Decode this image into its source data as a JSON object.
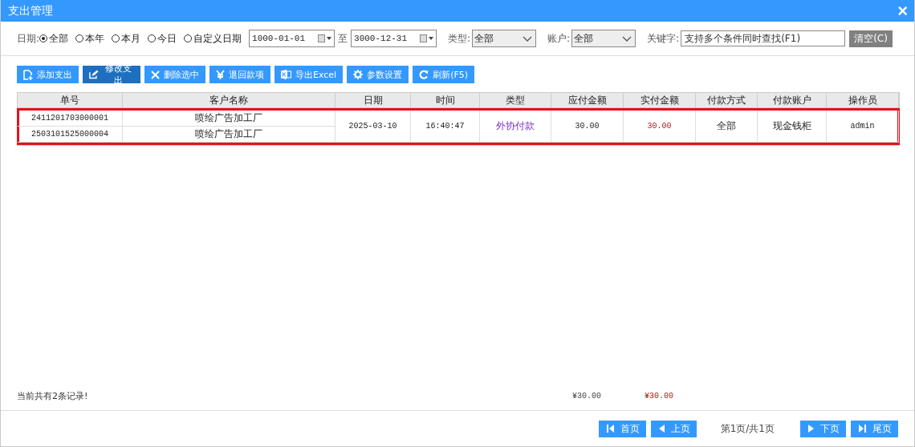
{
  "window": {
    "title": "支出管理",
    "close": "×"
  },
  "filters": {
    "date_label": "日期:",
    "date_options": [
      {
        "label": "全部",
        "selected": true
      },
      {
        "label": "本年",
        "selected": false
      },
      {
        "label": "本月",
        "selected": false
      },
      {
        "label": "今日",
        "selected": false
      },
      {
        "label": "自定义日期",
        "selected": false
      }
    ],
    "date_from": "1000-01-01",
    "date_sep": "至",
    "date_to": "3000-12-31",
    "type_label": "类型:",
    "type_value": "全部",
    "account_label": "账户:",
    "account_value": "全部",
    "keyword_label": "关键字:",
    "keyword_placeholder": "支持多个条件同时查找(F1)",
    "clear_button": "清空(C)"
  },
  "toolbar": [
    {
      "label": "添加支出",
      "kind": "add",
      "selected": false
    },
    {
      "label": "修改支出",
      "kind": "edit",
      "selected": true
    },
    {
      "label": "删除选中",
      "kind": "delete",
      "selected": false
    },
    {
      "label": "退回款项",
      "kind": "yen",
      "selected": false
    },
    {
      "label": "导出Excel",
      "kind": "excel",
      "selected": false
    },
    {
      "label": "参数设置",
      "kind": "gear",
      "selected": false
    },
    {
      "label": "刷新(F5)",
      "kind": "refresh",
      "selected": false
    }
  ],
  "table": {
    "columns": [
      "单号",
      "客户名称",
      "日期",
      "时间",
      "类型",
      "应付金额",
      "实付金额",
      "付款方式",
      "付款账户",
      "操作员"
    ],
    "groups": [
      {
        "selected": true,
        "rows": [
          {
            "number": "2411201703000001",
            "customer": "喷绘广告加工厂"
          },
          {
            "number": "2503101525000004",
            "customer": "喷绘广告加工厂"
          }
        ],
        "date": "2025-03-10",
        "time": "16:40:47",
        "type": "外协付款",
        "payable": "30.00",
        "paid": "30.00",
        "method": "全部",
        "account": "现金钱柜",
        "operator": "admin"
      }
    ]
  },
  "summary": {
    "count": "当前共有2条记录!",
    "payable_total": "¥30.00",
    "paid_total": "¥30.00"
  },
  "pager": {
    "first": "首页",
    "prev": "上页",
    "info": "第1页/共1页",
    "next": "下页",
    "last": "尾页"
  }
}
